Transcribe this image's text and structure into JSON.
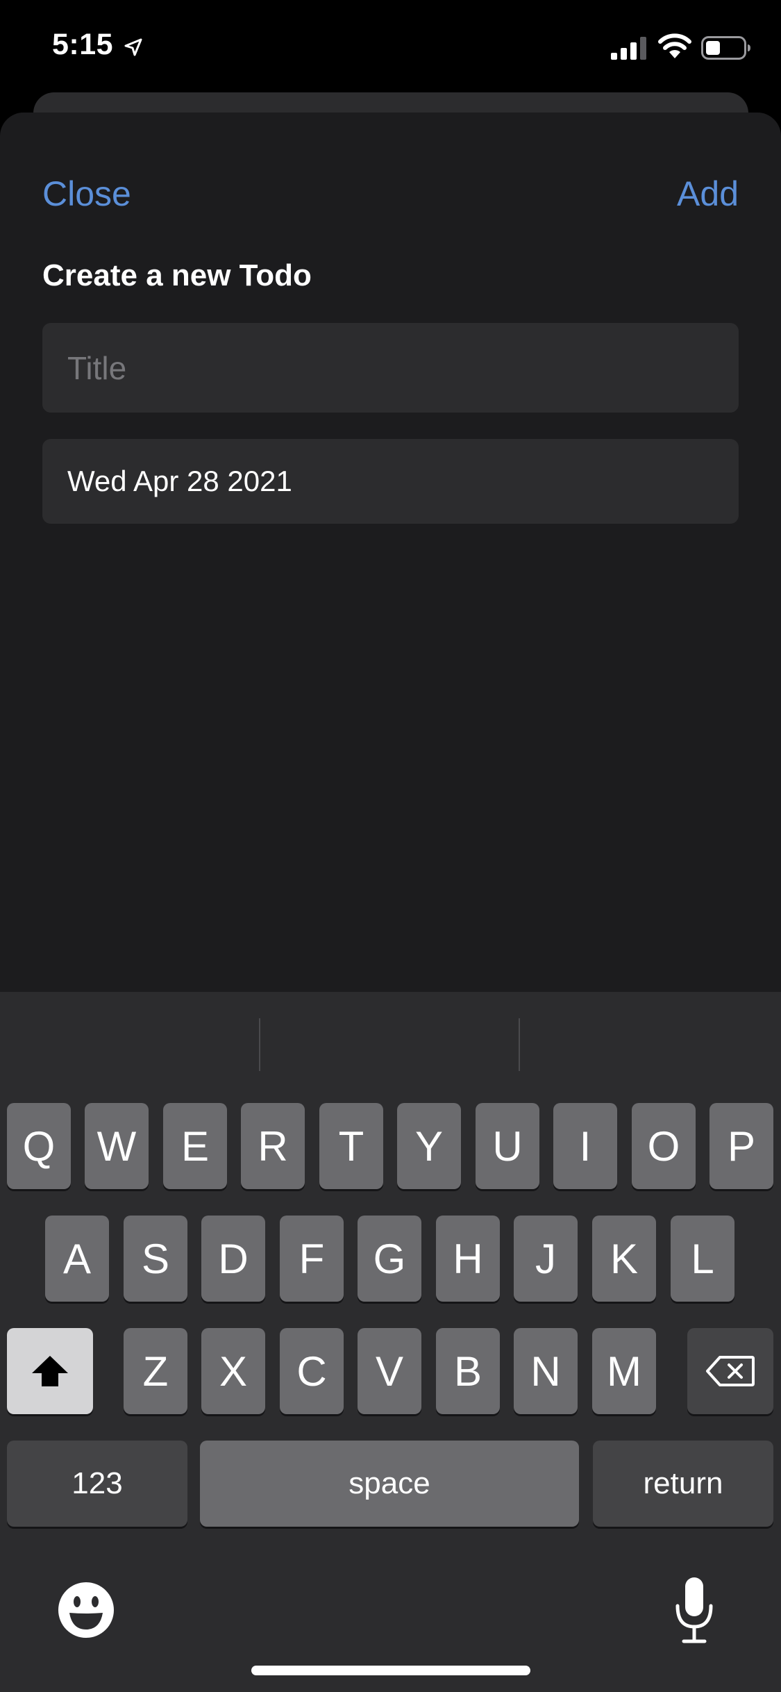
{
  "status_bar": {
    "time": "5:15",
    "icons": [
      "location-arrow-icon",
      "cellular-signal-icon",
      "wifi-icon",
      "battery-icon"
    ]
  },
  "sheet": {
    "close_label": "Close",
    "add_label": "Add",
    "title": "Create a new Todo",
    "title_field": {
      "placeholder": "Title",
      "value": ""
    },
    "date_field": {
      "value": "Wed Apr 28 2021"
    }
  },
  "keyboard": {
    "row1": [
      "Q",
      "W",
      "E",
      "R",
      "T",
      "Y",
      "U",
      "I",
      "O",
      "P"
    ],
    "row2": [
      "A",
      "S",
      "D",
      "F",
      "G",
      "H",
      "J",
      "K",
      "L"
    ],
    "row3": [
      "Z",
      "X",
      "C",
      "V",
      "B",
      "N",
      "M"
    ],
    "numbers_label": "123",
    "space_label": "space",
    "return_label": "return",
    "icons": [
      "shift-icon",
      "backspace-icon",
      "emoji-icon",
      "microphone-icon"
    ]
  },
  "colors": {
    "accent": "#5b8fd9",
    "sheet_background": "#1c1c1e",
    "field_background": "#2c2c2e",
    "keyboard_background": "#2c2c2e",
    "key_background": "#6b6b6e"
  }
}
